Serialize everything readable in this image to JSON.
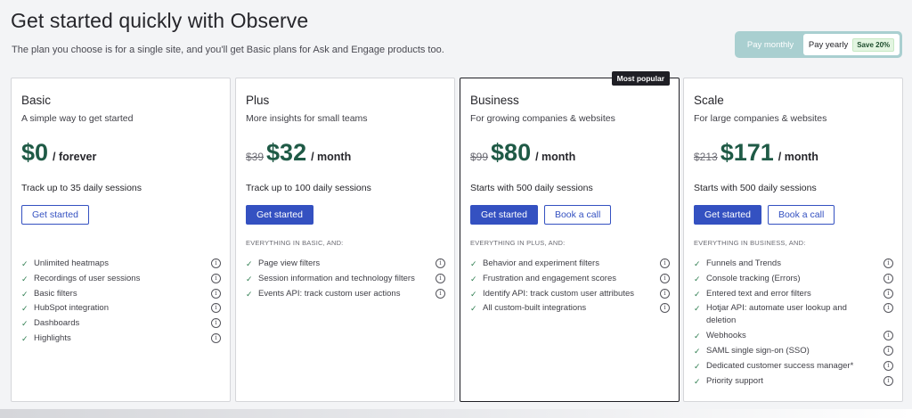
{
  "header": {
    "title": "Get started quickly with Observe",
    "subtitle": "The plan you choose is for a single site, and you'll get Basic plans for Ask and Engage products too."
  },
  "billing": {
    "monthly_label": "Pay monthly",
    "yearly_label": "Pay yearly",
    "save_badge": "Save 20%"
  },
  "plans": [
    {
      "name": "Basic",
      "desc": "A simple way to get started",
      "old_price": "",
      "price": "$0",
      "period": "/ forever",
      "sessions": "Track up to 35 daily sessions",
      "primary_button": "Get started",
      "secondary_button": "",
      "includes": "",
      "features": [
        "Unlimited heatmaps",
        "Recordings of user sessions",
        "Basic filters",
        "HubSpot integration",
        "Dashboards",
        "Highlights"
      ]
    },
    {
      "name": "Plus",
      "desc": "More insights for small teams",
      "old_price": "$39",
      "price": "$32",
      "period": "/ month",
      "sessions": "Track up to 100 daily sessions",
      "primary_button": "Get started",
      "secondary_button": "",
      "includes": "EVERYTHING IN BASIC, AND:",
      "features": [
        "Page view filters",
        "Session information and technology filters",
        "Events API: track custom user actions"
      ]
    },
    {
      "name": "Business",
      "desc": "For growing companies & websites",
      "badge": "Most popular",
      "old_price": "$99",
      "price": "$80",
      "period": "/ month",
      "sessions": "Starts with 500 daily sessions",
      "primary_button": "Get started",
      "secondary_button": "Book a call",
      "includes": "EVERYTHING IN PLUS, AND:",
      "features": [
        "Behavior and experiment filters",
        "Frustration and engagement scores",
        "Identify API: track custom user attributes",
        "All custom-built integrations"
      ]
    },
    {
      "name": "Scale",
      "desc": "For large companies & websites",
      "old_price": "$213",
      "price": "$171",
      "period": "/ month",
      "sessions": "Starts with 500 daily sessions",
      "primary_button": "Get started",
      "secondary_button": "Book a call",
      "includes": "EVERYTHING IN BUSINESS, AND:",
      "features": [
        "Funnels and Trends",
        "Console tracking (Errors)",
        "Entered text and error filters",
        "Hotjar API: automate user lookup and deletion",
        "Webhooks",
        "SAML single sign-on (SSO)",
        "Dedicated customer success manager*",
        "Priority support"
      ]
    }
  ],
  "icons": {
    "check": "check-icon",
    "info": "info-icon"
  },
  "colors": {
    "price_green": "#1f5a46",
    "button_blue": "#3451c1",
    "toggle_teal": "#a9cfd0",
    "check_green": "#2e7d4f"
  }
}
